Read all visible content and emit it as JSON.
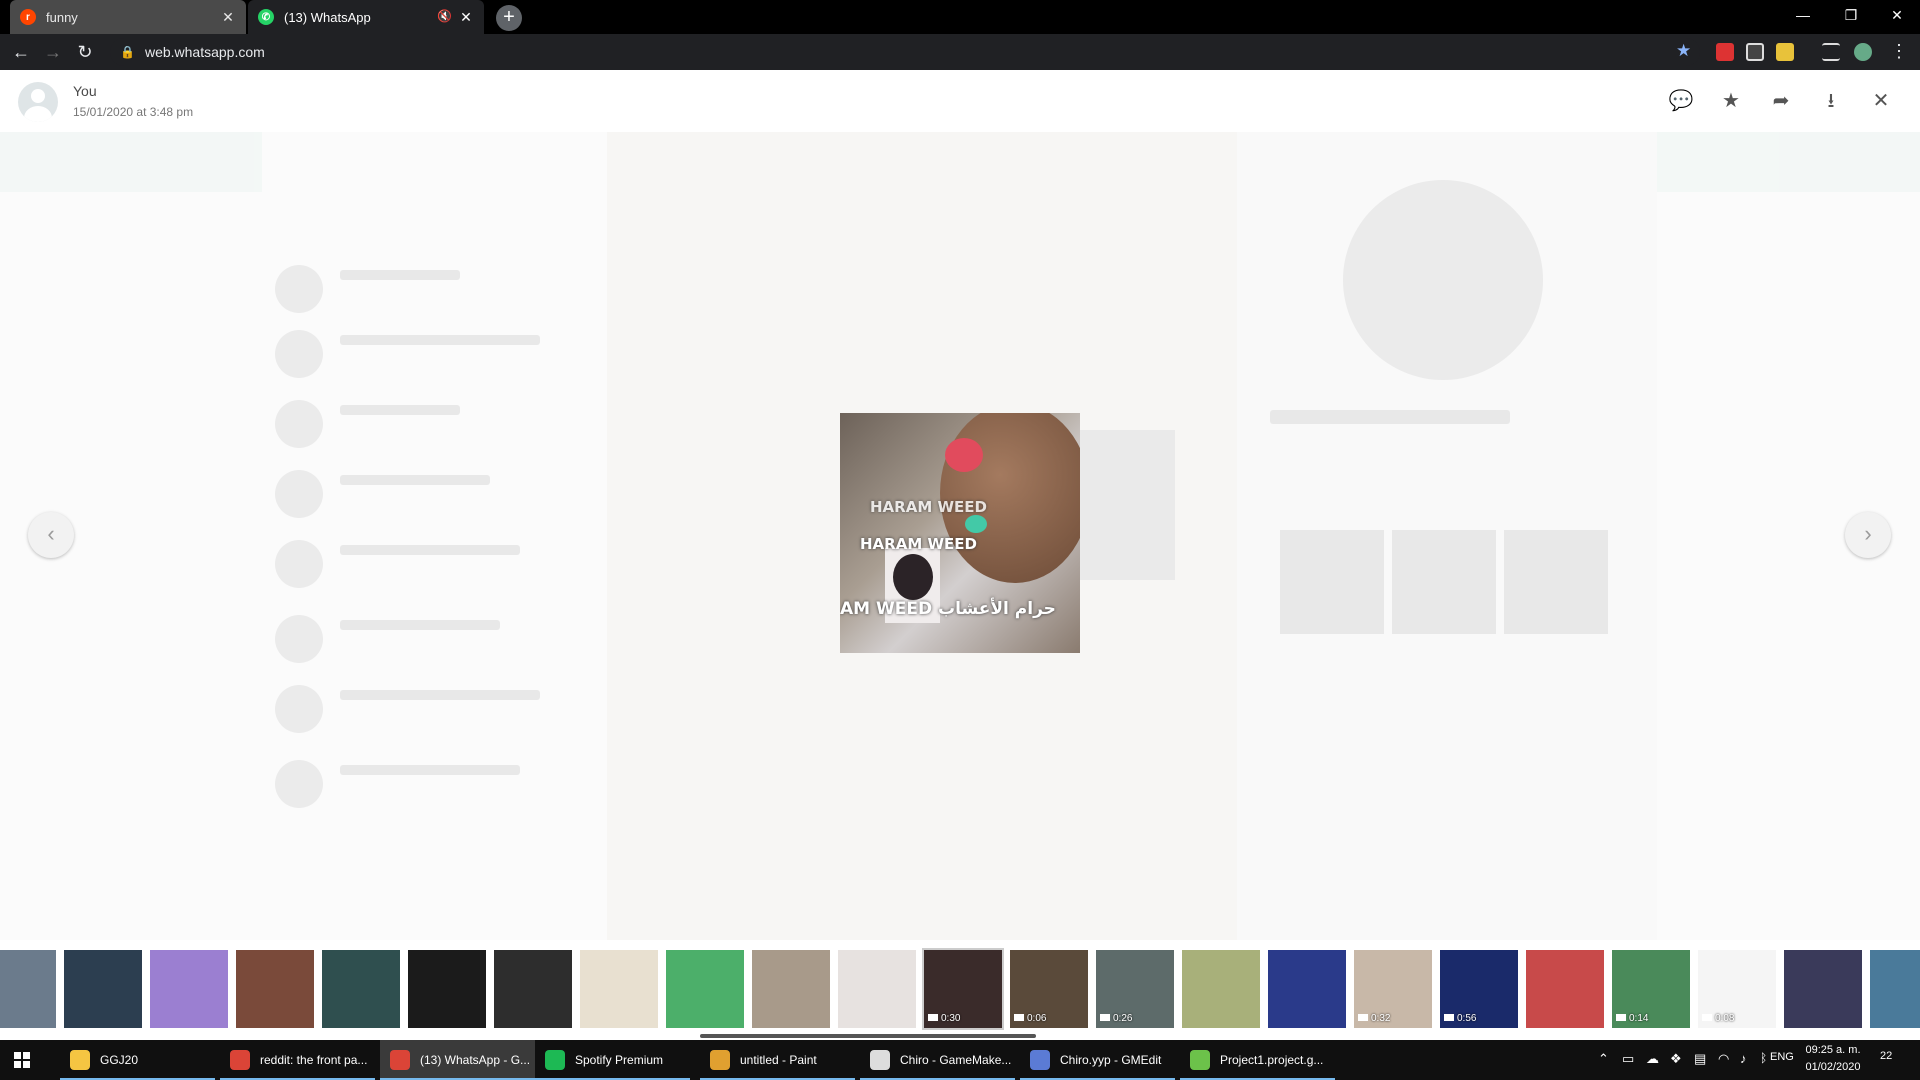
{
  "browser": {
    "tabs": [
      {
        "title": "funny",
        "icon": "reddit-icon",
        "close": "✕"
      },
      {
        "title": "(13) WhatsApp",
        "icon": "whatsapp-icon",
        "close": "✕",
        "mute": "🔇"
      }
    ],
    "new_tab": "+",
    "window_controls": {
      "minimize": "—",
      "restore": "❐",
      "close": "✕"
    },
    "nav": {
      "back": "←",
      "forward": "→",
      "reload": "↻"
    },
    "url": "web.whatsapp.com",
    "lock": "🔒",
    "bookmark_star": "★",
    "menu": "⋮"
  },
  "viewer": {
    "sender": "You",
    "timestamp": "15/01/2020 at 3:48 pm",
    "actions": {
      "reply": "💬",
      "star": "★",
      "forward": "➦",
      "download": "⭳",
      "close": "✕"
    },
    "media_captions": [
      "HARAM WEED",
      "HARAM WEED",
      "AM WEED حرام الأعشاب"
    ],
    "prev": "‹",
    "next": "›"
  },
  "thumbnails": [
    {
      "badge": ""
    },
    {
      "badge": ""
    },
    {
      "badge": ""
    },
    {
      "badge": ""
    },
    {
      "badge": ""
    },
    {
      "badge": ""
    },
    {
      "badge": ""
    },
    {
      "badge": ""
    },
    {
      "badge": ""
    },
    {
      "badge": ""
    },
    {
      "badge": ""
    },
    {
      "badge": "0:30"
    },
    {
      "badge": "0:06"
    },
    {
      "badge": "0:26"
    },
    {
      "badge": ""
    },
    {
      "badge": ""
    },
    {
      "badge": "0:32"
    },
    {
      "badge": "0:56"
    },
    {
      "badge": ""
    },
    {
      "badge": "0:14"
    },
    {
      "badge": "0:08"
    },
    {
      "badge": ""
    },
    {
      "badge": ""
    }
  ],
  "taskbar": {
    "items": [
      {
        "label": "GGJ20",
        "color": "#f5c542"
      },
      {
        "label": "reddit: the front pa...",
        "color": "#db4437"
      },
      {
        "label": "(13) WhatsApp - G...",
        "color": "#db4437"
      },
      {
        "label": "Spotify Premium",
        "color": "#1db954"
      },
      {
        "label": "untitled - Paint",
        "color": "#e0a030"
      },
      {
        "label": "Chiro - GameMake...",
        "color": "#dddddd"
      },
      {
        "label": "Chiro.yyp - GMEdit",
        "color": "#5b7bd5"
      },
      {
        "label": "Project1.project.g...",
        "color": "#6cc24a"
      }
    ],
    "tray": {
      "language": "ENG",
      "time": "09:25 a. m.",
      "date": "01/02/2020",
      "notifications": "22"
    }
  }
}
